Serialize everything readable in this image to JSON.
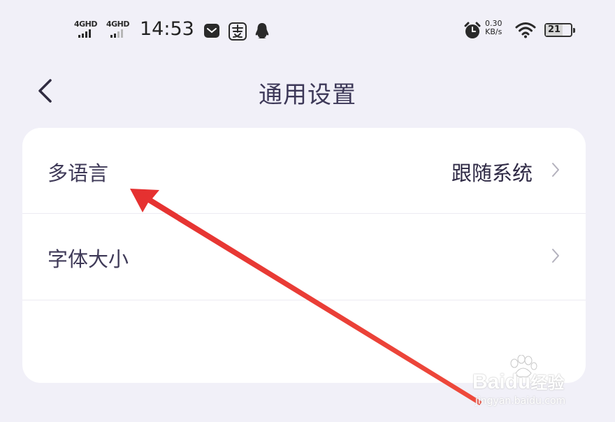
{
  "status_bar": {
    "signal1_label": "4GHD",
    "signal2_label": "4GHD",
    "time": "14:53",
    "net_speed": "0.30",
    "net_unit": "KB/s",
    "battery": "21"
  },
  "header": {
    "title": "通用设置"
  },
  "settings": {
    "items": [
      {
        "label": "多语言",
        "value": "跟随系统"
      },
      {
        "label": "字体大小",
        "value": ""
      }
    ]
  },
  "watermark": {
    "brand": "Baidu",
    "brand_cn": "经验",
    "url": "jingyan.baidu.com"
  },
  "colors": {
    "background": "#f1f0f8",
    "card": "#ffffff",
    "text": "#3f3a58",
    "arrow": "#e8302f"
  }
}
